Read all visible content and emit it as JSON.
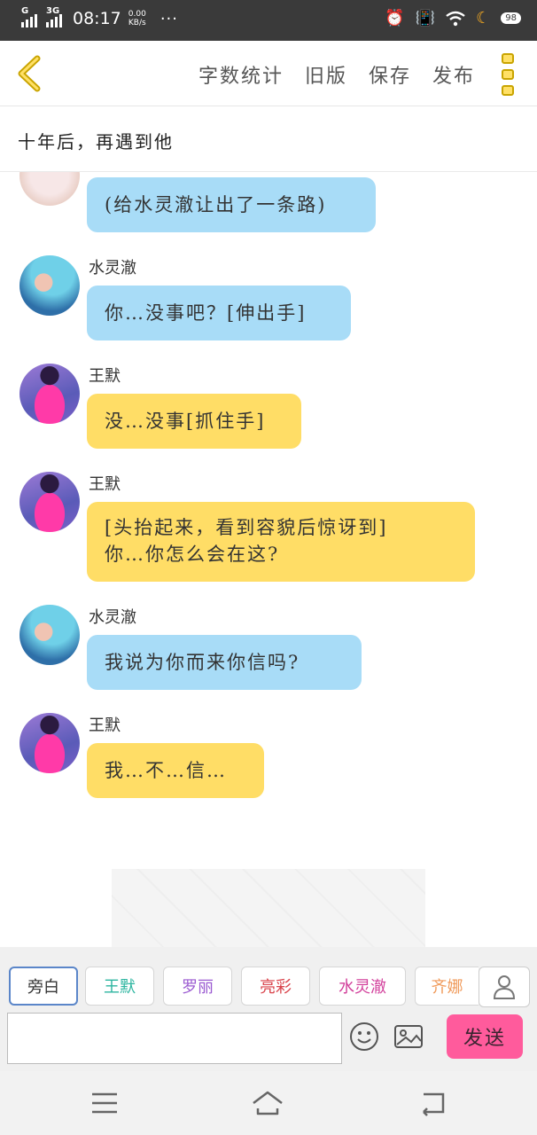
{
  "status_bar": {
    "network_1": "G",
    "network_2": "3G",
    "time": "08:17",
    "speed_value": "0.00",
    "speed_unit": "KB/s",
    "more": "···",
    "battery": "98"
  },
  "toolbar": {
    "word_count": "字数统计",
    "old_version": "旧版",
    "save": "保存",
    "publish": "发布"
  },
  "story_title": "十年后，再遇到他",
  "messages": [
    {
      "text": "(给水灵澈让出了一条路)",
      "color": "#a8dcf7"
    },
    {
      "name": "水灵澈",
      "text": "你…没事吧？[伸出手]",
      "color": "#a8dcf7"
    },
    {
      "name": "王默",
      "text": "没…没事[抓住手]",
      "color": "#ffdd66"
    },
    {
      "name": "王默",
      "text": "[头抬起来，看到容貌后惊讶到]\n你…你怎么会在这?",
      "color": "#ffdd66"
    },
    {
      "name": "水灵澈",
      "text": "我说为你而来你信吗?",
      "color": "#a8dcf7"
    },
    {
      "name": "王默",
      "text": "我…不…信…",
      "color": "#ffdd66"
    }
  ],
  "roles": [
    {
      "label": "旁白",
      "color": "#333333"
    },
    {
      "label": "王默",
      "color": "#2cb5a0"
    },
    {
      "label": "罗丽",
      "color": "#9b5bd1"
    },
    {
      "label": "亮彩",
      "color": "#d9424a"
    },
    {
      "label": "水灵澈",
      "color": "#d23f9b"
    },
    {
      "label": "齐娜",
      "color": "#f09a5a"
    }
  ],
  "input": {
    "value": "",
    "placeholder": ""
  },
  "send_label": "发送",
  "icons": {
    "back": "chevron-left-icon",
    "more": "more-vertical-icon",
    "person": "person-icon",
    "emoji": "smile-icon",
    "image": "image-icon",
    "menu": "menu-icon",
    "home": "home-icon",
    "back_nav": "return-icon"
  },
  "colors": {
    "accent": "#ff5b9c",
    "blue_bubble": "#a8dcf7",
    "yellow_bubble": "#ffdd66",
    "back_arrow": "#c9a400"
  }
}
